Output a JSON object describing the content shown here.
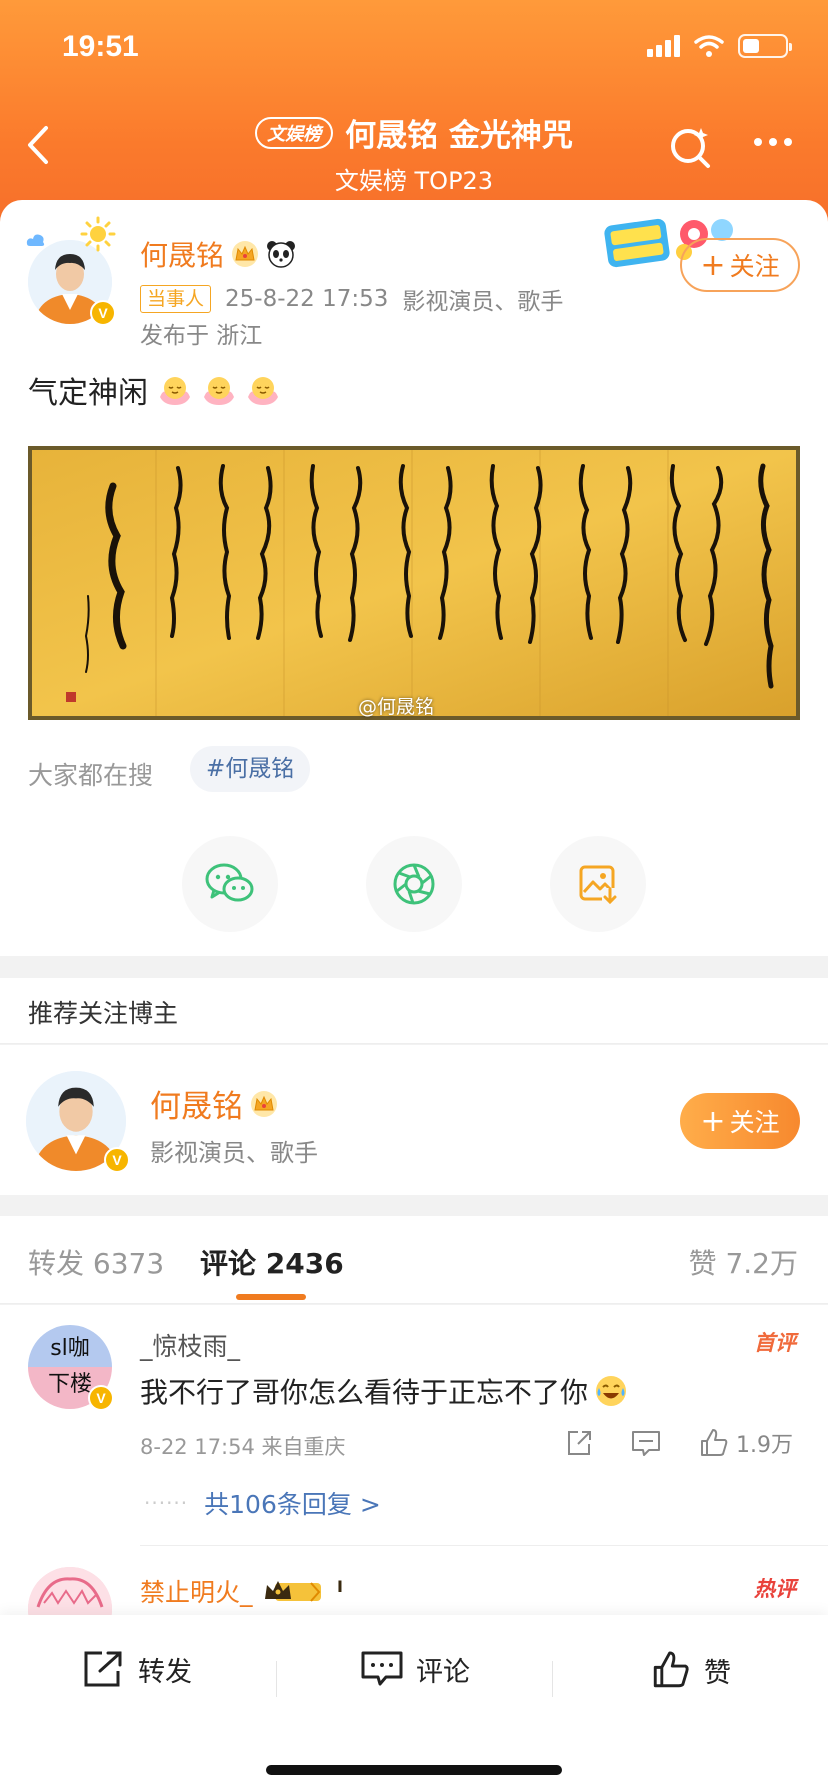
{
  "status_bar": {
    "time": "19:51"
  },
  "nav": {
    "badge": "文娱榜",
    "title": "何晟铭 金光神咒",
    "subtitle": "文娱榜 TOP23"
  },
  "post": {
    "author": "何晟铭",
    "tag": "当事人",
    "time": "25-8-22 17:53",
    "category": "影视演员、歌手",
    "location": "发布于 浙江",
    "follow_label": "关注",
    "text": "气定神闲",
    "watermark": "@何晟铭",
    "search_label": "大家都在搜",
    "search_tag": "#何晟铭",
    "share_icons": [
      "wechat-icon",
      "moments-icon",
      "save-image-icon"
    ]
  },
  "recommend": {
    "header": "推荐关注博主",
    "name": "何晟铭",
    "desc": "影视演员、歌手",
    "follow_label": "关注"
  },
  "tabs": {
    "repost": "转发 6373",
    "comment": "评论 2436",
    "like": "赞 7.2万"
  },
  "comments": [
    {
      "avatar_top": "sl咖",
      "avatar_bottom": "下楼",
      "name": "_惊枝雨_",
      "badge": "首评",
      "text": "我不行了哥你怎么看待于正忘不了你",
      "meta": "8-22 17:54  来自重庆",
      "likes": "1.9万",
      "replies": "共106条回复 >"
    },
    {
      "name": "禁止明火_",
      "badge": "热评",
      "level": "I"
    }
  ],
  "bottom_bar": {
    "repost": "转发",
    "comment": "评论",
    "like": "赞"
  },
  "colors": {
    "brand_orange": "#f07b1f",
    "header_gradient_top": "#ff9a3a",
    "link_blue": "#4a76b8"
  }
}
